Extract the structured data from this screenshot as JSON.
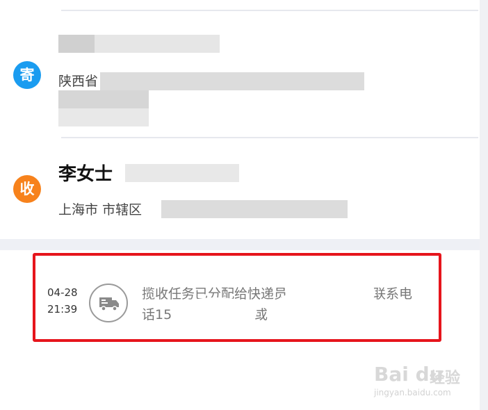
{
  "sender": {
    "badge": "寄",
    "address_prefix": "陕西省"
  },
  "recipient": {
    "badge": "收",
    "name": "李女士",
    "address_prefix": "上海市 市辖区"
  },
  "tracking": {
    "date": "04-28",
    "time": "21:39",
    "icon": "truck-icon",
    "line1_start": "揽收任务已分配给快递员",
    "line1_end": "联系电",
    "line2_start": "话15",
    "line2_mid": "或"
  },
  "watermark": {
    "logo": "Bai du",
    "text": "经验",
    "url": "jingyan.baidu.com"
  },
  "colors": {
    "send_badge": "#1a9cf0",
    "recv_badge": "#f7821c",
    "highlight": "#e6151c"
  }
}
